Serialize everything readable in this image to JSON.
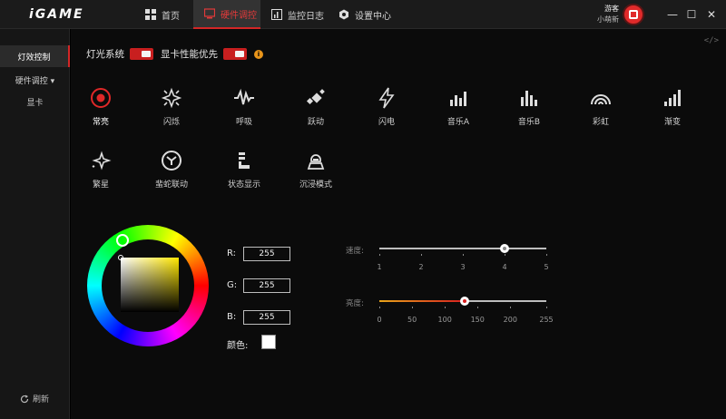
{
  "app": {
    "logo": "iGAME"
  },
  "nav": [
    {
      "label": "首页",
      "icon": "home-grid-icon"
    },
    {
      "label": "硬件调控",
      "icon": "monitor-icon"
    },
    {
      "label": "监控日志",
      "icon": "chart-icon"
    },
    {
      "label": "设置中心",
      "icon": "hexagon-settings-icon"
    }
  ],
  "user": {
    "role": "游客",
    "name": "小萌新"
  },
  "window": {
    "minimize": "—",
    "maximize": "☐",
    "close": "✕"
  },
  "sidebar": {
    "items": [
      {
        "label": "灯效控制"
      },
      {
        "label": "硬件调控 ▾"
      },
      {
        "label": "显卡"
      }
    ],
    "refresh": "刷新"
  },
  "main": {
    "code_icon": "</>",
    "light_system": {
      "label": "灯光系统",
      "on": true
    },
    "gpu_priority": {
      "label": "显卡性能优先",
      "on": true,
      "info": "i"
    },
    "effects": [
      {
        "label": "常亮",
        "icon": "steady-icon"
      },
      {
        "label": "闪烁",
        "icon": "flash-star-icon"
      },
      {
        "label": "呼吸",
        "icon": "pulse-icon"
      },
      {
        "label": "跃动",
        "icon": "jump-icon"
      },
      {
        "label": "闪电",
        "icon": "lightning-icon"
      },
      {
        "label": "音乐A",
        "icon": "bars-a-icon"
      },
      {
        "label": "音乐B",
        "icon": "bars-b-icon"
      },
      {
        "label": "彩虹",
        "icon": "rainbow-icon"
      },
      {
        "label": "渐变",
        "icon": "gradient-bars-icon"
      },
      {
        "label": "繁星",
        "icon": "stars-icon"
      },
      {
        "label": "蜚蛇联动",
        "icon": "link-icon"
      },
      {
        "label": "状态显示",
        "icon": "status-icon"
      },
      {
        "label": "沉浸模式",
        "icon": "immersion-icon"
      }
    ],
    "rgb": {
      "r_label": "R:",
      "r": "255",
      "g_label": "G:",
      "g": "255",
      "b_label": "B:",
      "b": "255"
    },
    "color_label": "颜色:",
    "speed": {
      "label": "速度:",
      "ticks": [
        "1",
        "2",
        "3",
        "4",
        "5"
      ],
      "value": 4,
      "min": 1,
      "max": 5
    },
    "brightness": {
      "label": "亮度:",
      "ticks": [
        "0",
        "50",
        "100",
        "150",
        "200",
        "255"
      ],
      "value": 130,
      "min": 0,
      "max": 255
    }
  },
  "colors": {
    "accent": "#d32626",
    "background": "#0b0b0b"
  }
}
